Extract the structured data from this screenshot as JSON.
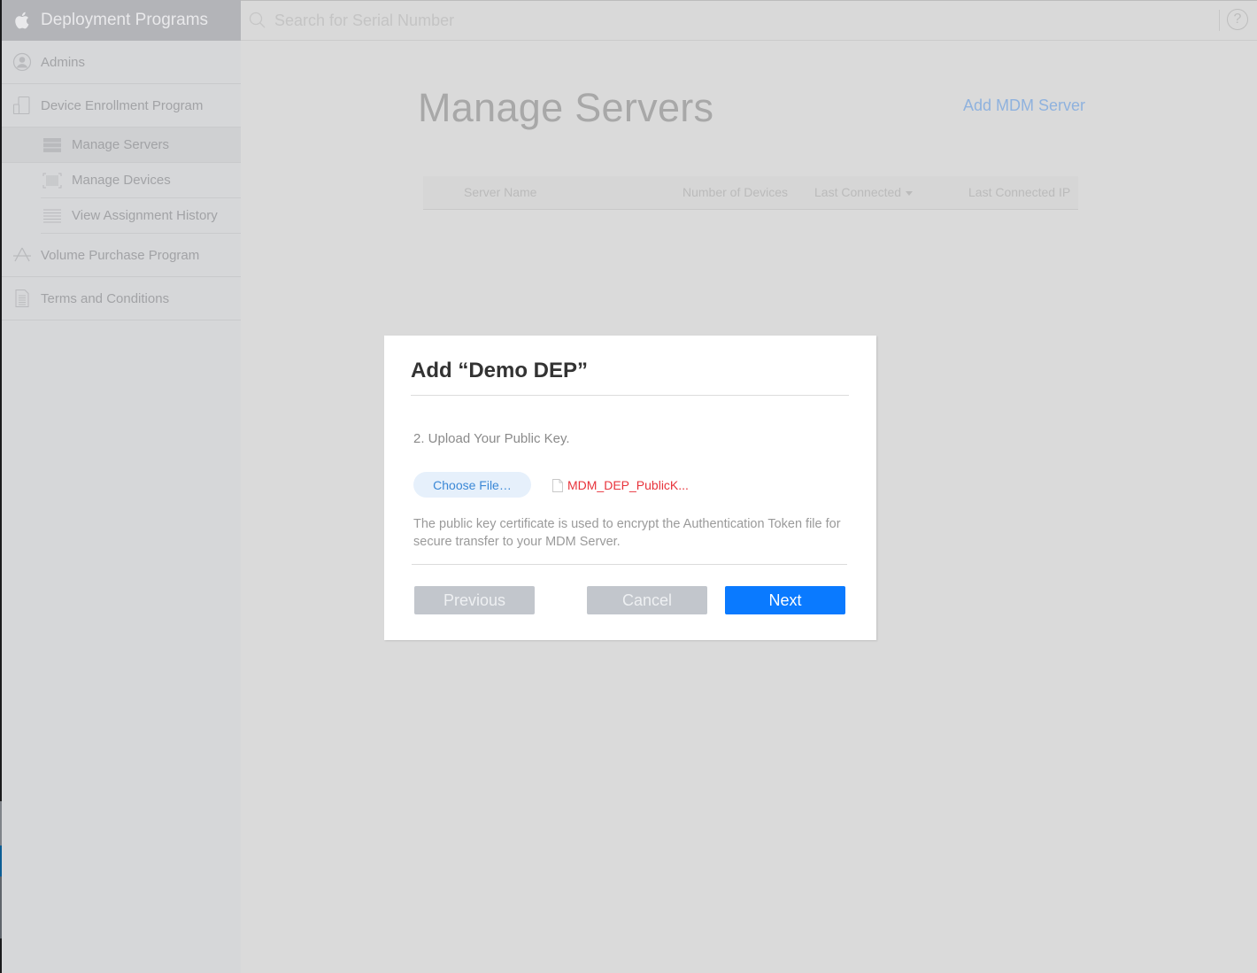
{
  "sidebar": {
    "title": "Deployment Programs",
    "items": [
      {
        "label": "Admins",
        "icon": "person-circle-icon"
      },
      {
        "label": "Device Enrollment Program",
        "icon": "devices-icon",
        "children": [
          {
            "label": "Manage Servers",
            "icon": "server-icon",
            "active": true
          },
          {
            "label": "Manage Devices",
            "icon": "barcode-icon"
          },
          {
            "label": "View Assignment History",
            "icon": "list-icon"
          }
        ]
      },
      {
        "label": "Volume Purchase Program",
        "icon": "app-store-icon"
      },
      {
        "label": "Terms and Conditions",
        "icon": "document-icon"
      }
    ]
  },
  "topbar": {
    "search_placeholder": "Search for Serial Number",
    "help_label": "?"
  },
  "main": {
    "title": "Manage Servers",
    "add_server_link": "Add MDM Server",
    "table": {
      "columns": [
        "Server Name",
        "Number of Devices",
        "Last Connected",
        "Last Connected IP"
      ],
      "sorted_column": "Last Connected"
    }
  },
  "modal": {
    "title": "Add “Demo DEP”",
    "step": "2. Upload Your Public Key.",
    "choose_file_label": "Choose File…",
    "file_name": "MDM_DEP_PublicK...",
    "description": "The public key certificate is used to encrypt the Authentication Token file for secure transfer to your MDM Server.",
    "buttons": {
      "previous": "Previous",
      "cancel": "Cancel",
      "next": "Next"
    }
  },
  "colors": {
    "primary": "#0a7aff",
    "link": "#8fb2de",
    "error_file": "#e8333b",
    "disabled_button": "#c2c6cc"
  }
}
